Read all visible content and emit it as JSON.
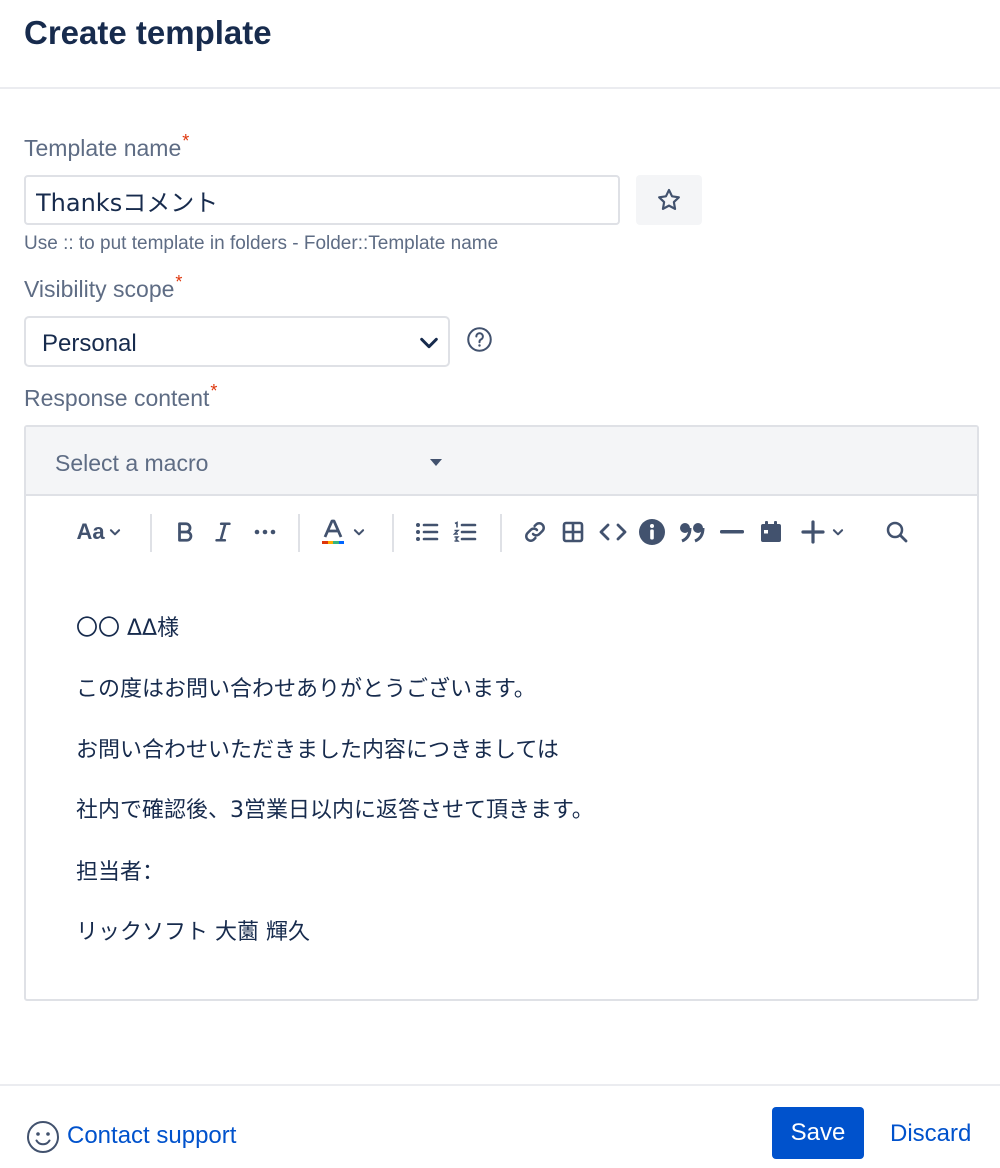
{
  "header": {
    "title": "Create template"
  },
  "template_name": {
    "label": "Template name",
    "required_mark": "*",
    "value": "Thanksコメント",
    "hint": "Use :: to put template in folders - Folder::Template name",
    "favorite_icon": "star-icon"
  },
  "visibility": {
    "label": "Visibility scope",
    "required_mark": "*",
    "selected": "Personal",
    "help_icon": "question-circle-icon"
  },
  "response": {
    "label": "Response content",
    "required_mark": "*",
    "macro_placeholder": "Select a macro",
    "toolbar": {
      "text_style": "Aa",
      "icons": [
        "text-style-icon",
        "bold-icon",
        "italic-icon",
        "more-formatting-icon",
        "text-color-icon",
        "bullet-list-icon",
        "numbered-list-icon",
        "link-icon",
        "table-icon",
        "code-icon",
        "info-panel-icon",
        "quote-icon",
        "divider-icon",
        "date-icon",
        "insert-icon",
        "search-icon"
      ]
    },
    "lines": [
      "〇〇 ΔΔ様",
      "この度はお問い合わせありがとうございます。",
      "お問い合わせいただきました内容につきましては",
      "社内で確認後、3営業日以内に返答させて頂きます。",
      "担当者：",
      "リックソフト 大薗 輝久"
    ]
  },
  "footer": {
    "support_label": "Contact support",
    "save_label": "Save",
    "discard_label": "Discard"
  },
  "colors": {
    "primary": "#0052cc",
    "text": "#172b4d",
    "subtle": "#5e6c84",
    "required": "#de350b"
  }
}
